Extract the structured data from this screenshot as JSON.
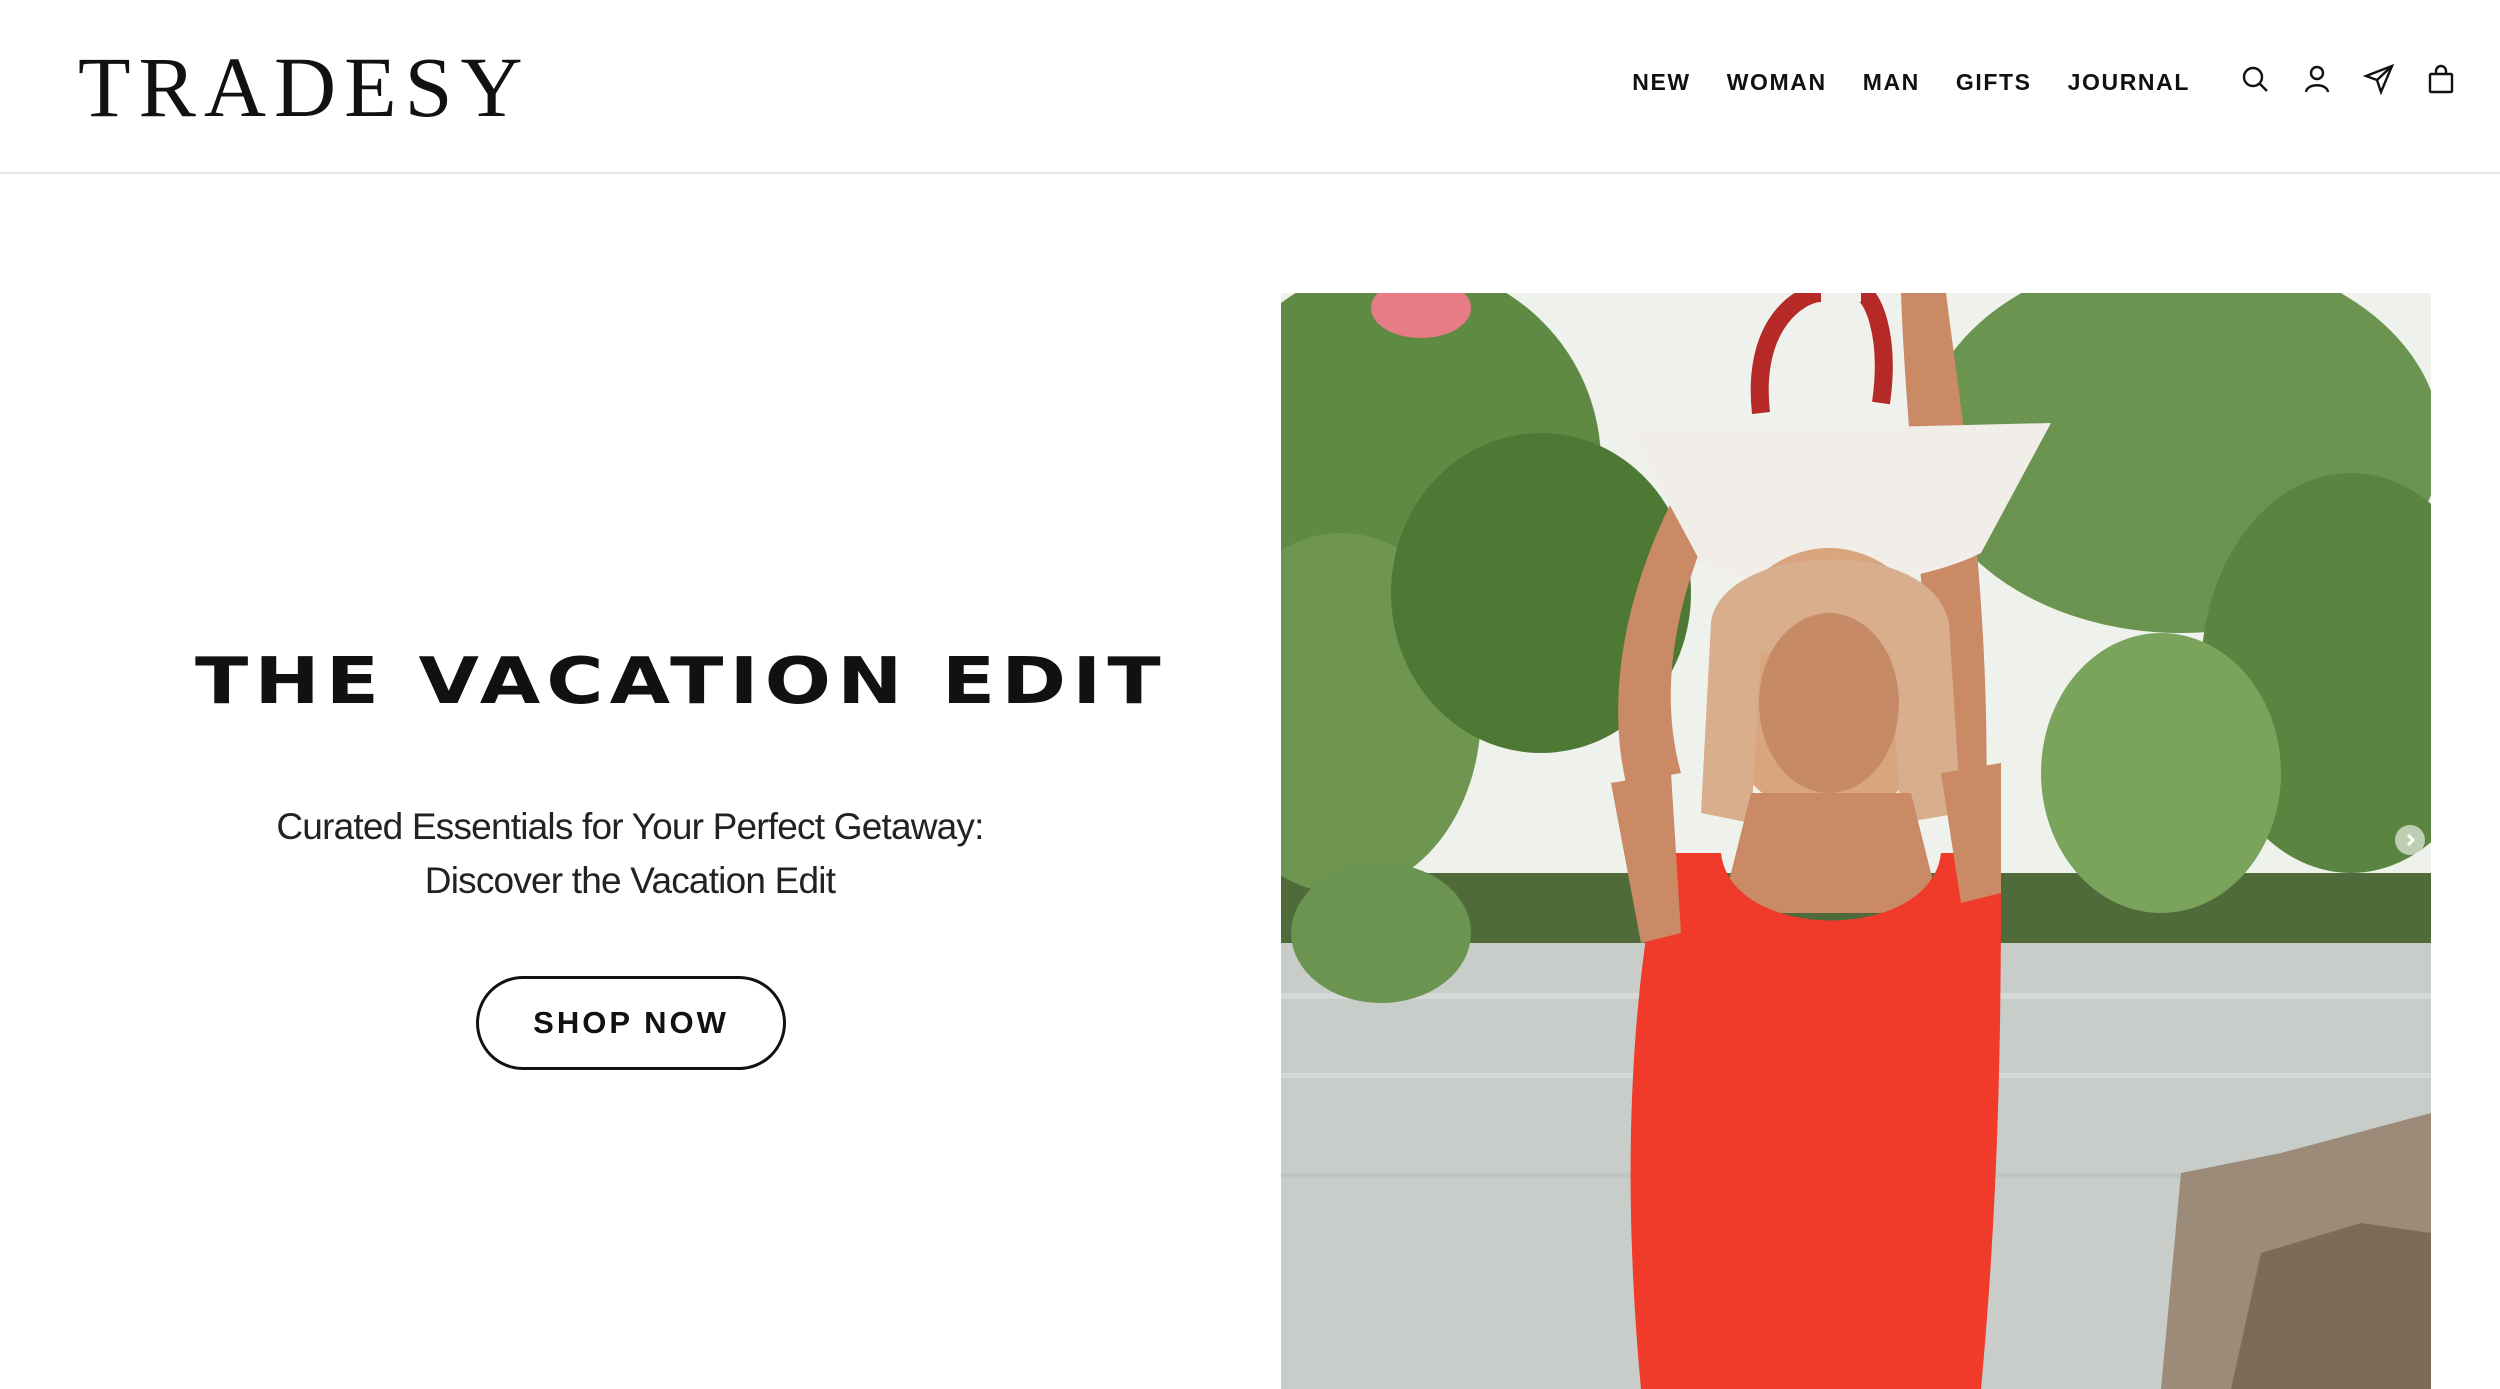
{
  "brand": {
    "name": "TRADESY"
  },
  "nav": {
    "items": [
      {
        "label": "NEW"
      },
      {
        "label": "WOMAN"
      },
      {
        "label": "MAN"
      },
      {
        "label": "GIFTS"
      },
      {
        "label": "JOURNAL"
      }
    ],
    "icons": [
      "search-icon",
      "account-icon",
      "send-icon",
      "bag-icon"
    ]
  },
  "hero": {
    "title": "THE VACATION EDIT",
    "subtitle_line1": "Curated Essentials for Your Perfect Getaway:",
    "subtitle_line2": "Discover the Vacation Edit",
    "cta_label": "SHOP NOW"
  },
  "colors": {
    "text": "#111111",
    "swimsuit": "#f03a2a",
    "foliage": "#5a7f3c",
    "water": "#c9cfcf"
  }
}
